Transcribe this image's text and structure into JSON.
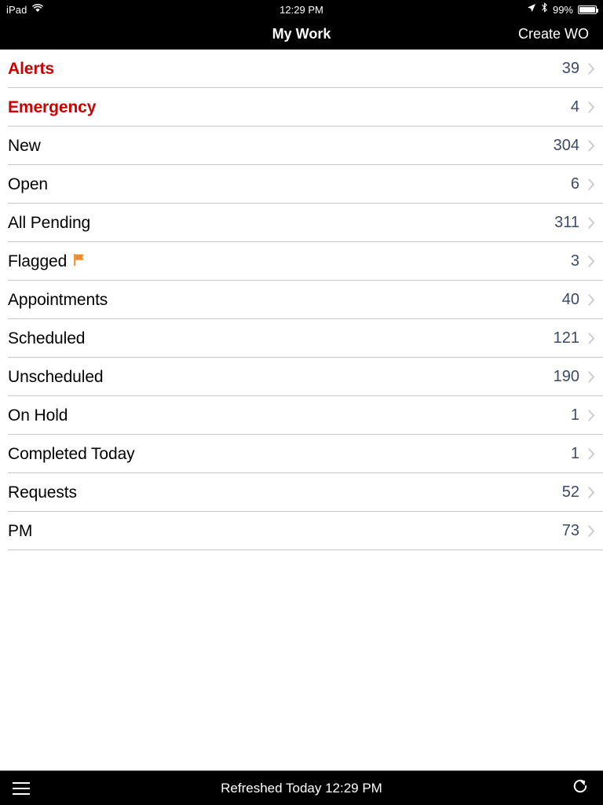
{
  "statusbar": {
    "device": "iPad",
    "wifi_icon": "wifi-icon",
    "time": "12:29 PM",
    "location_icon": "location-arrow-icon",
    "bluetooth_icon": "bluetooth-icon",
    "battery_percent": "99%",
    "battery_icon": "battery-icon"
  },
  "navbar": {
    "title": "My Work",
    "right_action": "Create WO"
  },
  "list": {
    "rows": [
      {
        "label": "Alerts",
        "count": "39",
        "style": "red",
        "flag": false
      },
      {
        "label": "Emergency",
        "count": "4",
        "style": "red",
        "flag": false
      },
      {
        "label": "New",
        "count": "304",
        "style": "plain",
        "flag": false
      },
      {
        "label": "Open",
        "count": "6",
        "style": "plain",
        "flag": false
      },
      {
        "label": "All Pending",
        "count": "311",
        "style": "plain",
        "flag": false
      },
      {
        "label": "Flagged",
        "count": "3",
        "style": "plain",
        "flag": true
      },
      {
        "label": "Appointments",
        "count": "40",
        "style": "plain",
        "flag": false
      },
      {
        "label": "Scheduled",
        "count": "121",
        "style": "plain",
        "flag": false
      },
      {
        "label": "Unscheduled",
        "count": "190",
        "style": "plain",
        "flag": false
      },
      {
        "label": "On Hold",
        "count": "1",
        "style": "plain",
        "flag": false
      },
      {
        "label": "Completed Today",
        "count": "1",
        "style": "plain",
        "flag": false
      },
      {
        "label": "Requests",
        "count": "52",
        "style": "plain",
        "flag": false
      },
      {
        "label": "PM",
        "count": "73",
        "style": "plain",
        "flag": false
      }
    ],
    "chevron_icon": "chevron-right-icon",
    "flag_icon": "orange-flag-icon"
  },
  "toolbar": {
    "menu_icon": "hamburger-menu-icon",
    "status_text": "Refreshed Today 12:29 PM",
    "refresh_icon": "refresh-icon"
  },
  "colors": {
    "alert_red": "#cc0000",
    "count_blue": "#3d4a66",
    "separator": "#c8c7cc",
    "flag_orange": "#f08a28",
    "bar_black": "#000000"
  }
}
